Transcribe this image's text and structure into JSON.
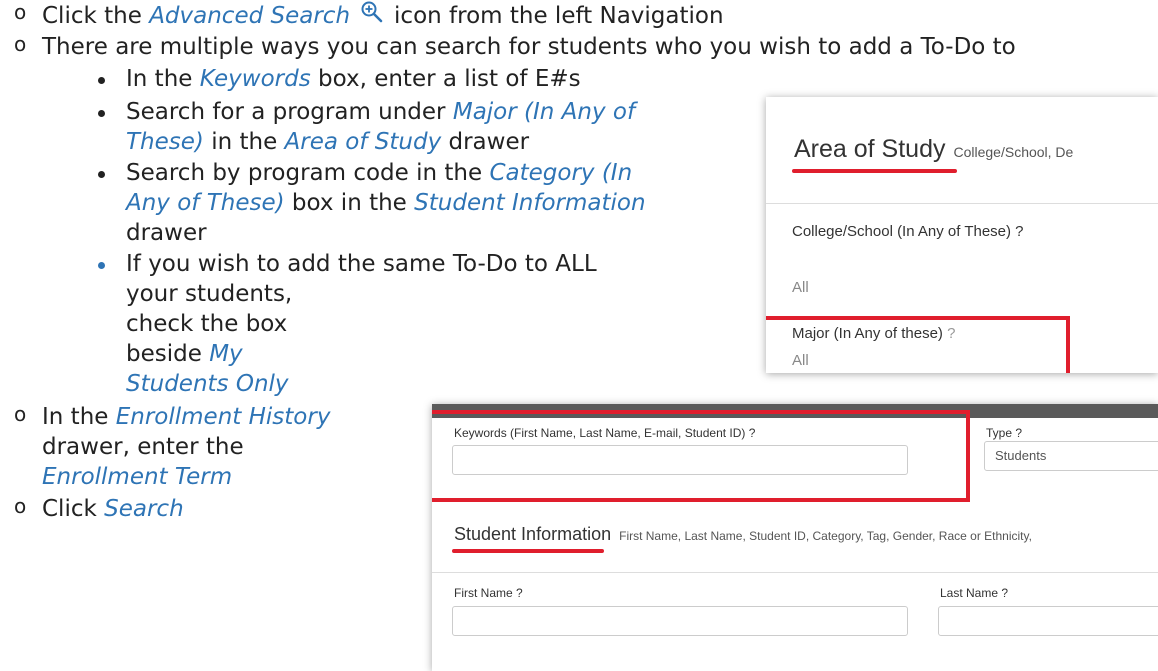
{
  "lines": {
    "l1_pre": "Click the ",
    "l1_em": "Advanced Search",
    "l1_post": "icon from the left Navigation",
    "l2": "There are multiple ways you can search for students who you wish to add a To-Do to",
    "b1_pre": "In the ",
    "b1_em": "Keywords",
    "b1_post": " box, enter a list of E#s",
    "b2a_pre": "Search for a program under ",
    "b2a_em": "Major (In Any of",
    "b2b_em": "These)",
    "b2b_mid": " in the ",
    "b2b_em2": "Area of Study",
    "b2b_post": " drawer",
    "b3a_pre": "Search by program code in the ",
    "b3a_em": "Category (In",
    "b3b_em": "Any of These)",
    "b3b_mid": " box in the ",
    "b3b_em2": "Student Information",
    "b3c": "drawer",
    "b4a": "If you wish to add the same To-Do to ALL",
    "b4b": "your students,",
    "b4c": "check the box",
    "b4d": "beside ",
    "b4d_em": "My",
    "b4e_em": "Students Only",
    "o3a_pre": "In the ",
    "o3a_em": "Enrollment History",
    "o3b": "drawer, enter the",
    "o3c_em": "Enrollment Term",
    "o4_pre": "Click ",
    "o4_em": "Search"
  },
  "shot1": {
    "title": "Area of Study",
    "subtitle": "College/School, De",
    "college_label": "College/School (In Any of These) ?",
    "college_value": "All",
    "major_label": "Major (In Any of these)",
    "major_q": " ?",
    "major_value": "All"
  },
  "shot2": {
    "keywords_label": "Keywords (First Name, Last Name, E-mail, Student ID) ?",
    "type_label": "Type ?",
    "type_value": "Students",
    "section_title": "Student Information",
    "section_sub": "First Name, Last Name, Student ID, Category, Tag, Gender, Race or Ethnicity,",
    "first_name_label": "First Name ?",
    "last_name_label": "Last Name ?"
  },
  "colors": {
    "accent": "#2e74b5",
    "highlight_red": "#e01e2d"
  }
}
